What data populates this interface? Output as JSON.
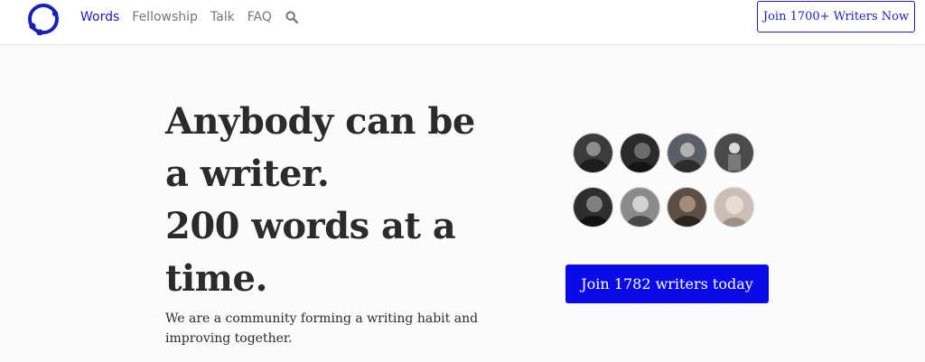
{
  "nav": {
    "items": [
      {
        "label": "Words",
        "active": true
      },
      {
        "label": "Fellowship",
        "active": false
      },
      {
        "label": "Talk",
        "active": false
      },
      {
        "label": "FAQ",
        "active": false
      }
    ],
    "search_icon": "search-icon",
    "join_top_label": "Join 1700+ Writers Now"
  },
  "hero": {
    "headline_lines": [
      "Anybody can be",
      "a writer.",
      "200 words at a",
      "time."
    ],
    "tagline": "We are a community forming a writing habit and improving together.",
    "cta_label": "Join 1782 writers today"
  },
  "avatars": {
    "count": 8,
    "tones": [
      "#3b3b3b",
      "#2a2a2a",
      "#5a5e66",
      "#4a4a4a",
      "#2e2e2e",
      "#8a8a8a",
      "#5b5048",
      "#c9bfb6"
    ]
  },
  "colors": {
    "brand": "#1a1fb5",
    "cta": "#0a0ae8",
    "background": "#fcfbfa",
    "text": "#2b2b2b"
  }
}
